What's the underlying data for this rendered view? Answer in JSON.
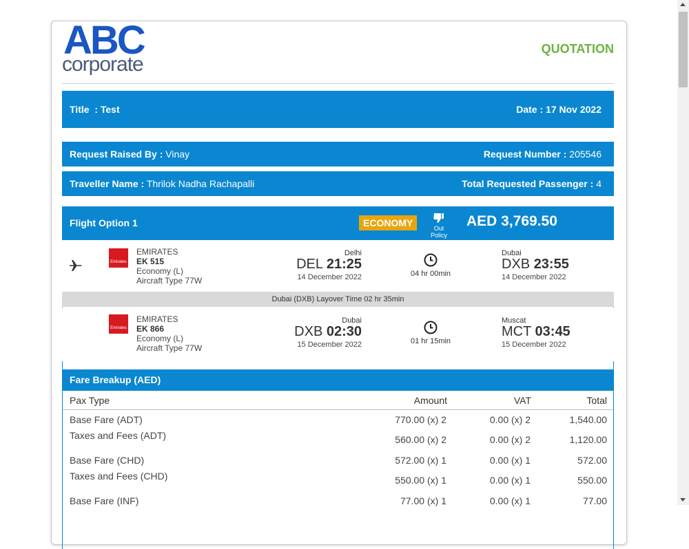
{
  "logo": {
    "line1": "ABC",
    "line2": "corporate"
  },
  "doc_type": "QUOTATION",
  "title_bar": {
    "title_label": "Title",
    "title_value": ": Test",
    "date_label": "Date :",
    "date_value": "17 Nov 2022"
  },
  "request_bar": {
    "raised_by_label": "Request Raised By :",
    "raised_by_value": "Vinay",
    "number_label": "Request Number :",
    "number_value": "205546"
  },
  "traveller_bar": {
    "name_label": "Traveller Name :",
    "name_value": "Thrilok Nadha Rachapalli",
    "passenger_label": "Total Requested Passenger :",
    "passenger_value": "4"
  },
  "flight_option": {
    "label": "Flight Option 1",
    "cabin_badge": "ECONOMY",
    "policy_label": "Out Policy",
    "price": "AED 3,769.50",
    "segments": [
      {
        "airline": "EMIRATES",
        "flight_no": "EK 515",
        "cabin": "Economy (L)",
        "aircraft": "Aircraft Type 77W",
        "dep_city": "Delhi",
        "dep_code": "DEL",
        "dep_time": "21:25",
        "dep_date": "14 December 2022",
        "duration": "04 hr 00min",
        "arr_city": "Dubai",
        "arr_code": "DXB",
        "arr_time": "23:55",
        "arr_date": "14 December 2022"
      },
      {
        "airline": "EMIRATES",
        "flight_no": "EK 866",
        "cabin": "Economy (L)",
        "aircraft": "Aircraft Type 77W",
        "dep_city": "Dubai",
        "dep_code": "DXB",
        "dep_time": "02:30",
        "dep_date": "15 December 2022",
        "duration": "01 hr 15min",
        "arr_city": "Muscat",
        "arr_code": "MCT",
        "arr_time": "03:45",
        "arr_date": "15 December 2022"
      }
    ],
    "layover": "Dubai (DXB) Layover Time 02 hr 35min",
    "airline_logo_text": "Emirates"
  },
  "fare": {
    "title": "Fare Breakup (AED)",
    "headers": [
      "Pax Type",
      "Amount",
      "VAT",
      "Total"
    ],
    "rows": [
      {
        "type": "Base Fare (ADT)",
        "amount": "770.00 (x) 2",
        "vat": "0.00 (x) 2",
        "total": "1,540.00"
      },
      {
        "type": "Taxes and Fees (ADT)",
        "amount": "560.00 (x) 2",
        "vat": "0.00 (x) 2",
        "total": "1,120.00"
      },
      {
        "type": "Base Fare (CHD)",
        "amount": "572.00 (x) 1",
        "vat": "0.00 (x) 1",
        "total": "572.00"
      },
      {
        "type": "Taxes and Fees (CHD)",
        "amount": "550.00 (x) 1",
        "vat": "0.00 (x) 1",
        "total": "550.00"
      },
      {
        "type": "Base Fare (INF)",
        "amount": "77.00 (x) 1",
        "vat": "0.00 (x) 1",
        "total": "77.00"
      }
    ]
  },
  "colors": {
    "brand_blue": "#0a87d0",
    "badge": "#e8a50e",
    "quotation": "#6cb33f",
    "logo_blue": "#1a56c4"
  },
  "icons": [
    "plane-icon",
    "clock-icon",
    "thumbs-down-icon",
    "emirates-logo"
  ]
}
